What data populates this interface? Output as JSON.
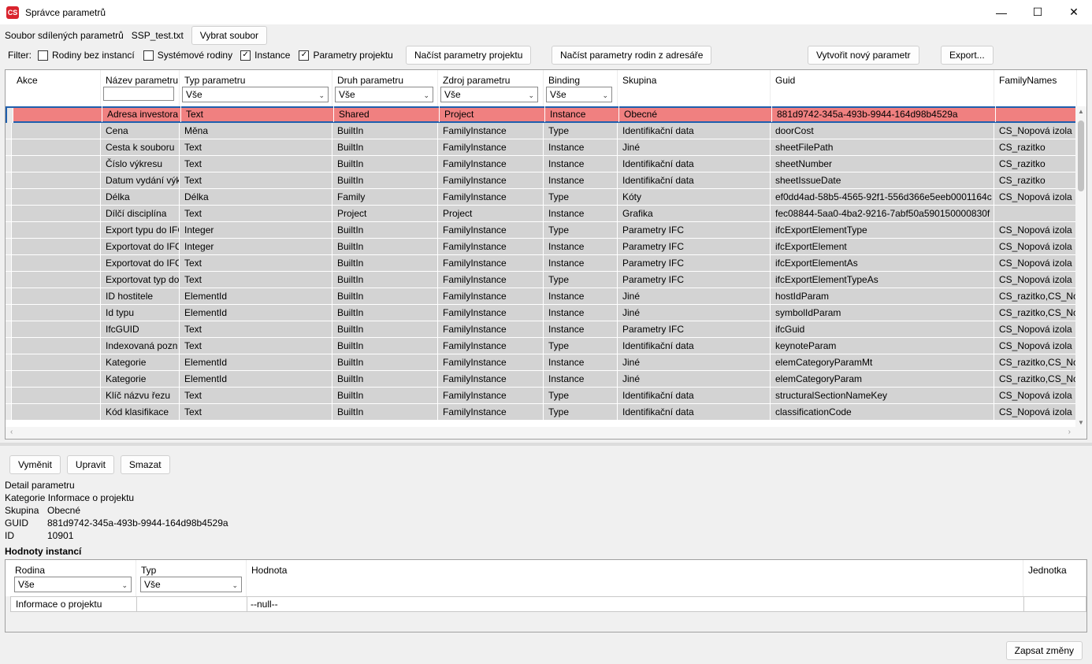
{
  "window": {
    "title": "Správce parametrů",
    "icon_text": "CS",
    "min": "—",
    "max": "☐",
    "close": "✕"
  },
  "shared": {
    "label": "Soubor sdílených parametrů",
    "file": "SSP_test.txt",
    "choose_btn": "Vybrat soubor"
  },
  "filter": {
    "label": "Filter:",
    "options": [
      {
        "label": "Rodiny bez instancí",
        "checked": false
      },
      {
        "label": "Systémové rodiny",
        "checked": false
      },
      {
        "label": "Instance",
        "checked": true
      },
      {
        "label": "Parametry projektu",
        "checked": true
      }
    ],
    "load_project_btn": "Načíst parametry projektu",
    "load_families_btn": "Načíst parametry rodin z adresáře",
    "create_btn": "Vytvořit nový parametr",
    "export_btn": "Export..."
  },
  "grid": {
    "columns": [
      "Akce",
      "Název parametru",
      "Typ parametru",
      "Druh parametru",
      "Zdroj parametru",
      "Binding",
      "Skupina",
      "Guid",
      "FamilyNames"
    ],
    "filter_value": "Vše",
    "rows": [
      [
        "",
        "Adresa investora",
        "Text",
        "Shared",
        "Project",
        "Instance",
        "Obecné",
        "881d9742-345a-493b-9944-164d98b4529a",
        ""
      ],
      [
        "",
        "Cena",
        "Měna",
        "BuiltIn",
        "FamilyInstance",
        "Type",
        "Identifikační data",
        "doorCost",
        "CS_Nopová izola"
      ],
      [
        "",
        "Cesta k souboru",
        "Text",
        "BuiltIn",
        "FamilyInstance",
        "Instance",
        "Jiné",
        "sheetFilePath",
        "CS_razitko"
      ],
      [
        "",
        "Číslo výkresu",
        "Text",
        "BuiltIn",
        "FamilyInstance",
        "Instance",
        "Identifikační data",
        "sheetNumber",
        "CS_razitko"
      ],
      [
        "",
        "Datum vydání výkr",
        "Text",
        "BuiltIn",
        "FamilyInstance",
        "Instance",
        "Identifikační data",
        "sheetIssueDate",
        "CS_razitko"
      ],
      [
        "",
        "Délka",
        "Délka",
        "Family",
        "FamilyInstance",
        "Type",
        "Kóty",
        "ef0dd4ad-58b5-4565-92f1-556d366e5eeb0001164c",
        "CS_Nopová izola"
      ],
      [
        "",
        "Dílčí disciplína",
        "Text",
        "Project",
        "Project",
        "Instance",
        "Grafika",
        "fec08844-5aa0-4ba2-9216-7abf50a590150000830f",
        ""
      ],
      [
        "",
        "Export typu do IFC",
        "Integer",
        "BuiltIn",
        "FamilyInstance",
        "Type",
        "Parametry IFC",
        "ifcExportElementType",
        "CS_Nopová izola"
      ],
      [
        "",
        "Exportovat do IFC",
        "Integer",
        "BuiltIn",
        "FamilyInstance",
        "Instance",
        "Parametry IFC",
        "ifcExportElement",
        "CS_Nopová izola"
      ],
      [
        "",
        "Exportovat do IFC",
        "Text",
        "BuiltIn",
        "FamilyInstance",
        "Instance",
        "Parametry IFC",
        "ifcExportElementAs",
        "CS_Nopová izola"
      ],
      [
        "",
        "Exportovat typ do",
        "Text",
        "BuiltIn",
        "FamilyInstance",
        "Type",
        "Parametry IFC",
        "ifcExportElementTypeAs",
        "CS_Nopová izola"
      ],
      [
        "",
        "ID hostitele",
        "ElementId",
        "BuiltIn",
        "FamilyInstance",
        "Instance",
        "Jiné",
        "hostIdParam",
        "CS_razitko,CS_Nc"
      ],
      [
        "",
        "Id typu",
        "ElementId",
        "BuiltIn",
        "FamilyInstance",
        "Instance",
        "Jiné",
        "symbolIdParam",
        "CS_razitko,CS_Nc"
      ],
      [
        "",
        "IfcGUID",
        "Text",
        "BuiltIn",
        "FamilyInstance",
        "Instance",
        "Parametry IFC",
        "ifcGuid",
        "CS_Nopová izola"
      ],
      [
        "",
        "Indexovaná pozn",
        "Text",
        "BuiltIn",
        "FamilyInstance",
        "Type",
        "Identifikační data",
        "keynoteParam",
        "CS_Nopová izola"
      ],
      [
        "",
        "Kategorie",
        "ElementId",
        "BuiltIn",
        "FamilyInstance",
        "Instance",
        "Jiné",
        "elemCategoryParamMt",
        "CS_razitko,CS_Nc"
      ],
      [
        "",
        "Kategorie",
        "ElementId",
        "BuiltIn",
        "FamilyInstance",
        "Instance",
        "Jiné",
        "elemCategoryParam",
        "CS_razitko,CS_Nc"
      ],
      [
        "",
        "Klíč názvu řezu",
        "Text",
        "BuiltIn",
        "FamilyInstance",
        "Type",
        "Identifikační data",
        "structuralSectionNameKey",
        "CS_Nopová izola"
      ],
      [
        "",
        "Kód klasifikace",
        "Text",
        "BuiltIn",
        "FamilyInstance",
        "Type",
        "Identifikační data",
        "classificationCode",
        "CS_Nopová izola"
      ]
    ]
  },
  "actions": {
    "replace": "Vyměnit",
    "edit": "Upravit",
    "delete": "Smazat"
  },
  "detail": {
    "title": "Detail parametru",
    "category_label": "Kategorie",
    "category": "Informace o projektu",
    "group_label": "Skupina",
    "group": "Obecné",
    "guid_label": "GUID",
    "guid": "881d9742-345a-493b-9944-164d98b4529a",
    "id_label": "ID",
    "id": "10901"
  },
  "instances": {
    "title": "Hodnoty instancí",
    "columns": [
      "Rodina",
      "Typ",
      "Hodnota",
      "Jednotka"
    ],
    "filter_value": "Vše",
    "row": [
      "Informace o projektu",
      "",
      "--null--",
      ""
    ]
  },
  "save_btn": "Zapsat změny"
}
